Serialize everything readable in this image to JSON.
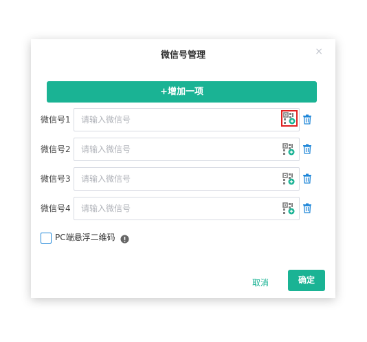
{
  "dialog": {
    "title": "微信号管理",
    "close_glyph": "×",
    "add_label": "+增加一项",
    "rows": [
      {
        "label": "微信号1",
        "placeholder": "请输入微信号",
        "value": ""
      },
      {
        "label": "微信号2",
        "placeholder": "请输入微信号",
        "value": ""
      },
      {
        "label": "微信号3",
        "placeholder": "请输入微信号",
        "value": ""
      },
      {
        "label": "微信号4",
        "placeholder": "请输入微信号",
        "value": ""
      }
    ],
    "float_qr": {
      "label": "PC端悬浮二维码",
      "checked": false
    },
    "cancel_label": "取消",
    "confirm_label": "确定"
  },
  "colors": {
    "accent": "#1ab394",
    "highlight_border": "#e02020",
    "trash_icon": "#1f86d8",
    "qr_icon": "#7f7f7f",
    "qr_badge": "#1ab394"
  },
  "icons": {
    "qr": "qr-code-upload-icon",
    "trash": "trash-icon",
    "info": "info-icon",
    "close": "close-icon"
  }
}
